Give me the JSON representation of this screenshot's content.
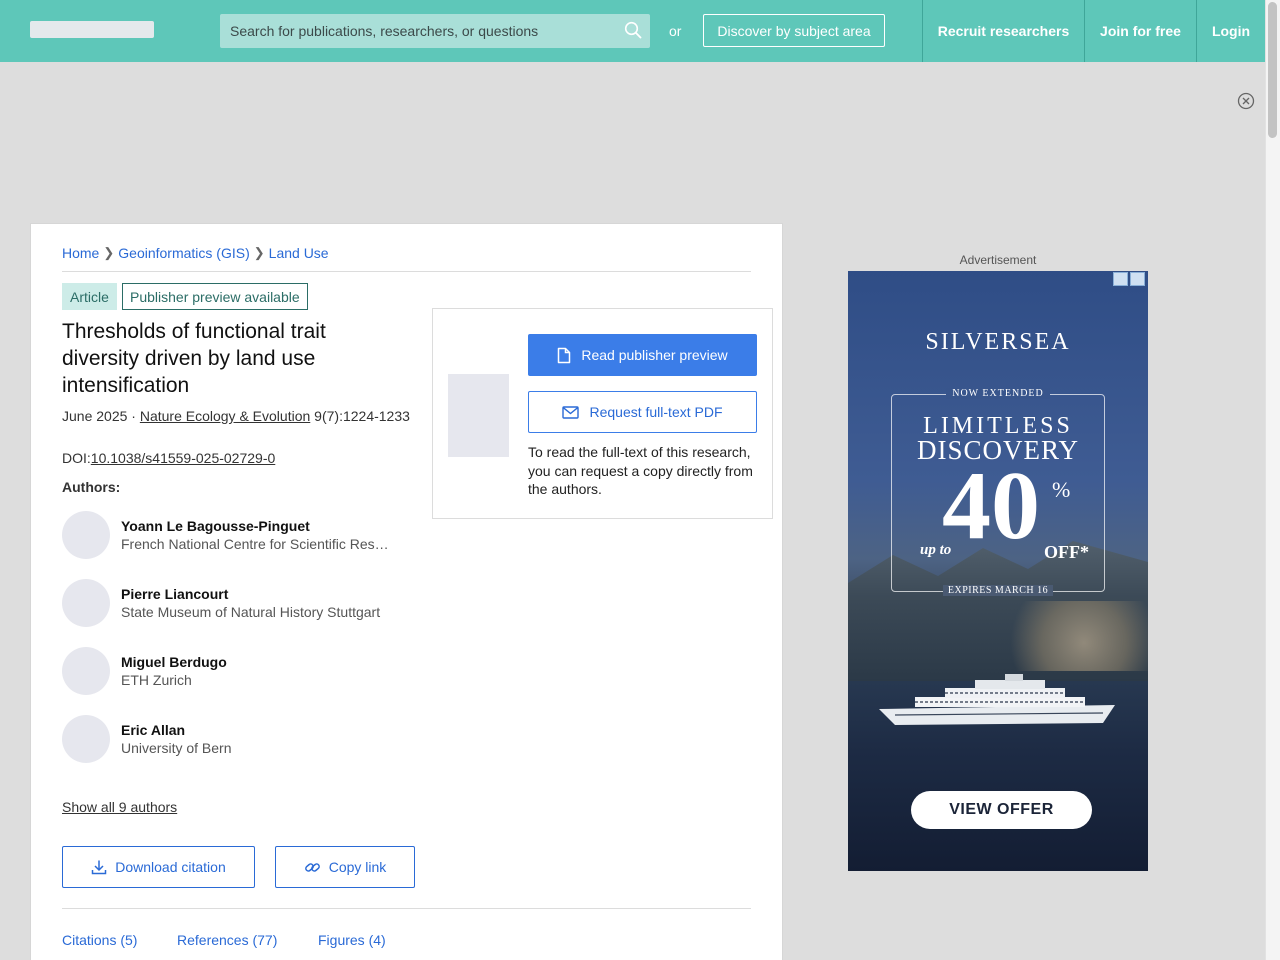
{
  "topbar": {
    "search_placeholder": "Search for publications, researchers, or questions",
    "or_text": "or",
    "discover_label": "Discover by subject area",
    "recruit_label": "Recruit researchers",
    "join_label": "Join for free",
    "login_label": "Login"
  },
  "breadcrumb": {
    "items": [
      "Home",
      "Geoinformatics (GIS)",
      "Land Use"
    ]
  },
  "article": {
    "type_badge": "Article",
    "preview_badge": "Publisher preview available",
    "title": "Thresholds of functional trait diversity driven by land use intensification",
    "date": "June 2025 · ",
    "journal": "Nature Ecology & Evolution",
    "pages": " 9(7):1224-1233",
    "doi_prefix": "DOI:",
    "doi": "10.1038/s41559-025-02729-0",
    "authors_label": "Authors:",
    "authors": [
      {
        "name": "Yoann Le Bagousse-Pinguet",
        "affiliation": "French National Centre for Scientific Research"
      },
      {
        "name": "Pierre Liancourt",
        "affiliation": "State Museum of Natural History Stuttgart"
      },
      {
        "name": "Miguel Berdugo",
        "affiliation": "ETH Zurich"
      },
      {
        "name": "Eric Allan",
        "affiliation": "University of Bern"
      }
    ],
    "show_all": "Show all 9 authors",
    "download_citation": "Download citation",
    "copy_link": "Copy link"
  },
  "tabs": {
    "citations": "Citations (5)",
    "references": "References (77)",
    "figures": "Figures (4)"
  },
  "preview": {
    "read_label": "Read publisher preview",
    "request_label": "Request full-text PDF",
    "note": "To read the full-text of this research, you can request a copy directly from the authors."
  },
  "ad": {
    "label": "Advertisement",
    "brand": "SILVERSEA",
    "extended": "NOW EXTENDED",
    "line1": "LIMITLESS",
    "line2": "DISCOVERY",
    "up_to": "up to",
    "big": "40",
    "pct": "%",
    "off": "OFF*",
    "expires": "EXPIRES MARCH 16",
    "cta": "VIEW OFFER"
  },
  "colors": {
    "topbar": "#5ec7b9",
    "link": "#2a6ad6",
    "primary_button": "#3b7de8"
  },
  "icons": {
    "search": "search-icon",
    "close": "close-circle-icon",
    "download": "download-icon",
    "link": "link-icon",
    "document": "document-icon",
    "mail": "mail-icon"
  }
}
